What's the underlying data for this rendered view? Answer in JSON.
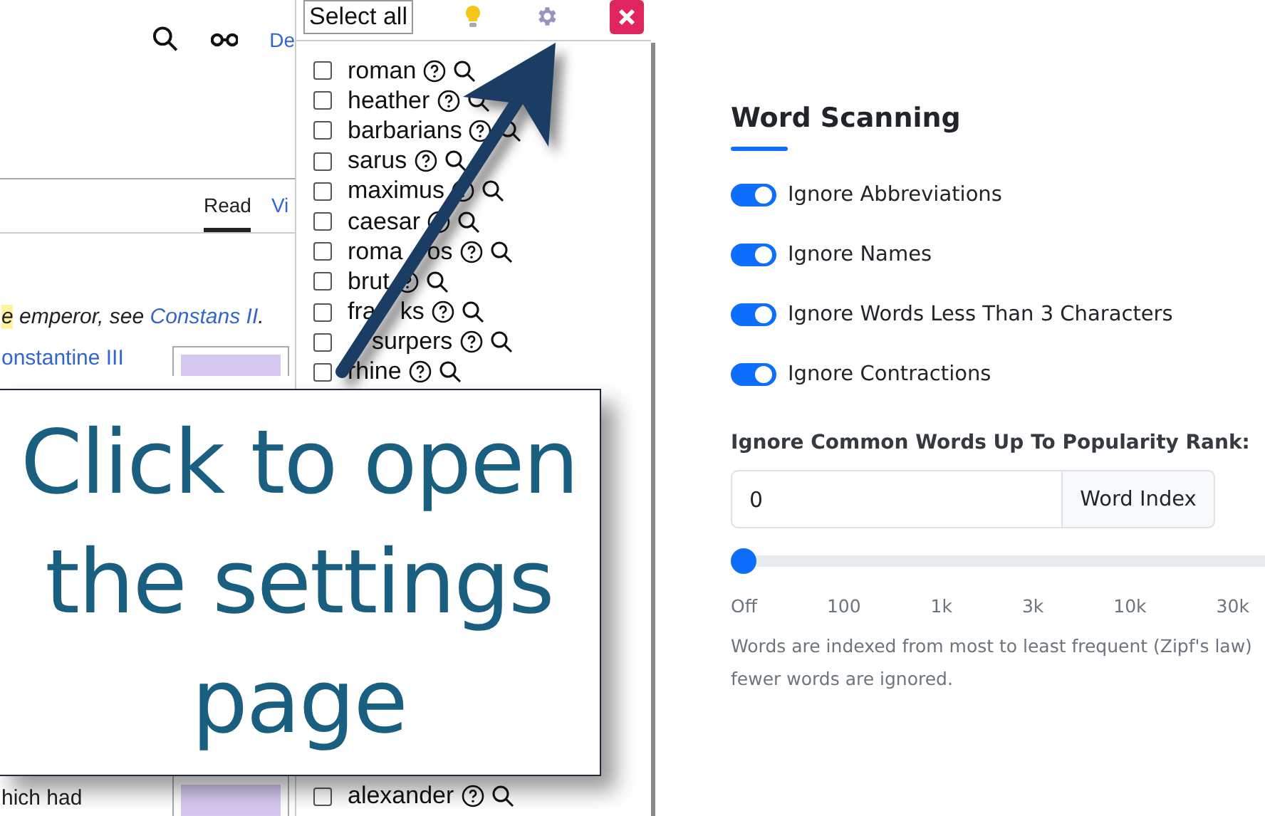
{
  "wiki": {
    "header_link": "De",
    "tabs": [
      {
        "label": "Read",
        "selected": true
      },
      {
        "label": "Vi",
        "selected": false
      }
    ],
    "hatnote": {
      "highlight": "e",
      "text": " emperor, see ",
      "link": "Constans II",
      "end": "."
    },
    "link": "onstantine III",
    "body_text": "hich had"
  },
  "popup": {
    "select_all": "Select all",
    "words": [
      {
        "word": "roman",
        "checked": false
      },
      {
        "word": "heather",
        "checked": false
      },
      {
        "word": "barbarians",
        "checked": false
      },
      {
        "word": "sarus",
        "checked": false
      },
      {
        "word": "maximus",
        "checked": false
      },
      {
        "word": "caesar",
        "checked": false
      },
      {
        "parts": [
          "roma",
          "os"
        ],
        "checked": false
      },
      {
        "word": "brut",
        "checked": false
      },
      {
        "parts": [
          "fra",
          "ks"
        ],
        "checked": false
      },
      {
        "parts": [
          "surpers"
        ],
        "lead_gap": true,
        "checked": false
      },
      {
        "word": "rhine",
        "checked": false
      },
      {
        "word": "alexander",
        "checked": false
      }
    ]
  },
  "callout": {
    "text": "Click to open the settings page"
  },
  "settings": {
    "title": "Word Scanning",
    "toggles": [
      {
        "label": "Ignore Abbreviations",
        "on": true
      },
      {
        "label": "Ignore Names",
        "on": true
      },
      {
        "label": "Ignore Words Less Than 3 Characters",
        "on": true
      },
      {
        "label": "Ignore Contractions",
        "on": true
      }
    ],
    "rank_label": "Ignore Common Words Up To Popularity Rank:",
    "rank_value": "0",
    "rank_addon": "Word Index",
    "slider": {
      "level": 0
    },
    "ticks": [
      "Off",
      "100",
      "1k",
      "3k",
      "10k",
      "30k"
    ],
    "help": [
      "Words are indexed from most to least frequent (Zipf's law)",
      "fewer words are ignored."
    ]
  }
}
